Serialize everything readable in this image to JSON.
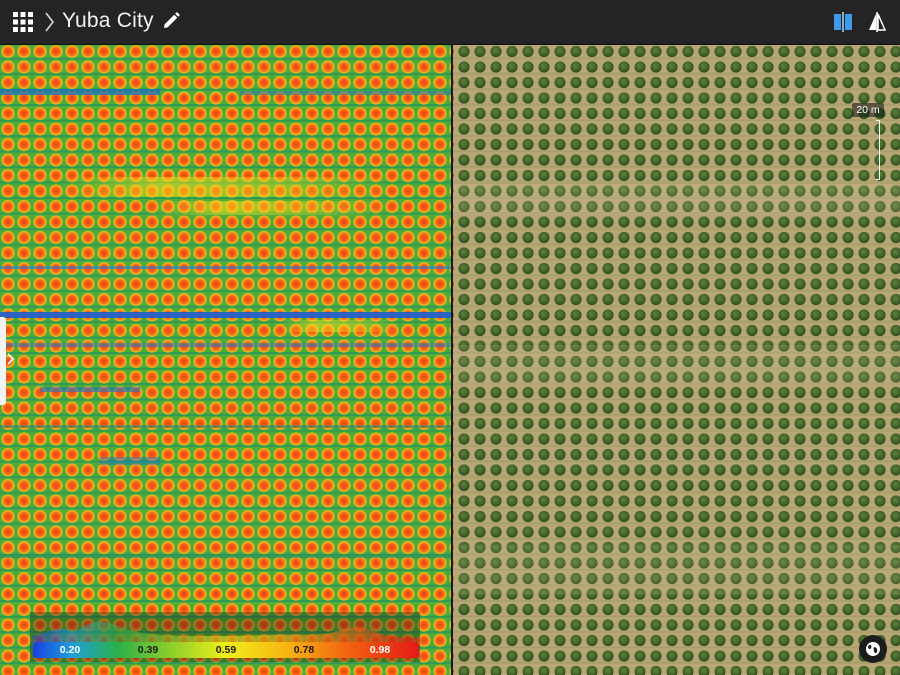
{
  "header": {
    "title": "Yuba City",
    "apps_icon": "apps-grid-icon",
    "breadcrumb_icon": "chevron-right-icon",
    "edit_icon": "pencil-icon",
    "split_view_icon": "split-view-icon",
    "swipe_compare_icon": "swipe-compare-icon",
    "active_color": "#3d9bea"
  },
  "map": {
    "left_layer": "vegetation-index-heatmap",
    "right_layer": "rgb-orthomosaic",
    "scale_label": "20 m",
    "globe_icon": "globe-icon",
    "sidebar_toggle_icon": "chevron-right-icon"
  },
  "legend": {
    "ticks": [
      "0.20",
      "0.39",
      "0.59",
      "0.78",
      "0.98"
    ],
    "colors": [
      "#1a3fe0",
      "#1fa0d8",
      "#2bb14a",
      "#8fcf2a",
      "#f1ee1a",
      "#f7b412",
      "#f36a12",
      "#e51a16"
    ]
  }
}
